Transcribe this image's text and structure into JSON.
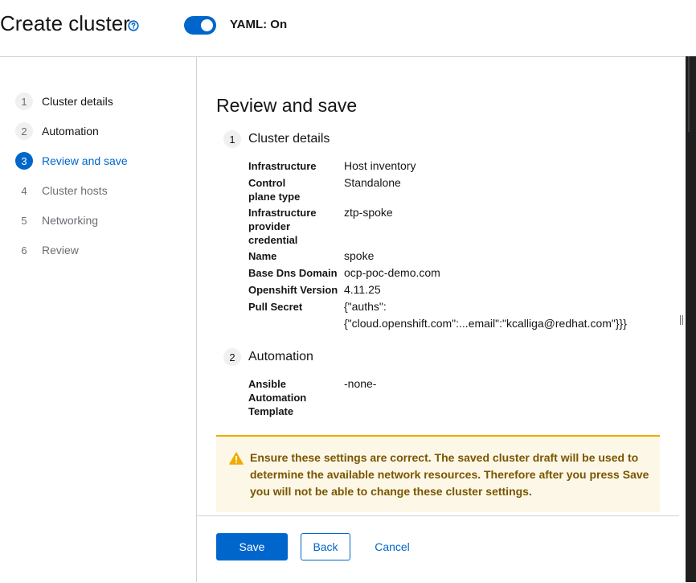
{
  "header": {
    "title": "Create cluster",
    "help_icon": "question-circle-icon",
    "yaml_toggle": {
      "label": "YAML: On",
      "on": true
    }
  },
  "nav": {
    "items": [
      {
        "num": "1",
        "label": "Cluster details",
        "state": "visited"
      },
      {
        "num": "2",
        "label": "Automation",
        "state": "visited"
      },
      {
        "num": "3",
        "label": "Review and save",
        "state": "current"
      },
      {
        "num": "4",
        "label": "Cluster hosts",
        "state": "disabled"
      },
      {
        "num": "5",
        "label": "Networking",
        "state": "disabled"
      },
      {
        "num": "6",
        "label": "Review",
        "state": "disabled"
      }
    ]
  },
  "main": {
    "title": "Review and save",
    "sections": [
      {
        "num": "1",
        "title": "Cluster details",
        "fields": [
          {
            "key": "Infrastructure",
            "value": "Host inventory"
          },
          {
            "key": "Control plane type",
            "value": "Standalone"
          },
          {
            "key": "Infrastructure provider credential",
            "value": "ztp-spoke"
          },
          {
            "key": "Name",
            "value": "spoke"
          },
          {
            "key": "Base Dns Domain",
            "value": "ocp-poc-demo.com"
          },
          {
            "key": "Openshift Version",
            "value": "4.11.25"
          },
          {
            "key": "Pull Secret",
            "value_line1": "{\"auths\":",
            "value_line2": "{\"cloud.openshift.com\":...email\":\"kcalliga@redhat.com\"}}}"
          }
        ]
      },
      {
        "num": "2",
        "title": "Automation",
        "fields": [
          {
            "key": "Ansible Automation Template",
            "value": "-none-"
          }
        ]
      }
    ]
  },
  "alert": {
    "icon": "exclamation-triangle-icon",
    "text": "Ensure these settings are correct. The saved cluster draft will be used to determine the available network resources. Therefore after you press Save you will not be able to change these cluster settings."
  },
  "footer": {
    "save_label": "Save",
    "back_label": "Back",
    "cancel_label": "Cancel"
  },
  "colors": {
    "primary": "#0066cc",
    "warning_border": "#f0ab00",
    "warning_bg": "#fdf7e7",
    "warning_text": "#795600"
  }
}
